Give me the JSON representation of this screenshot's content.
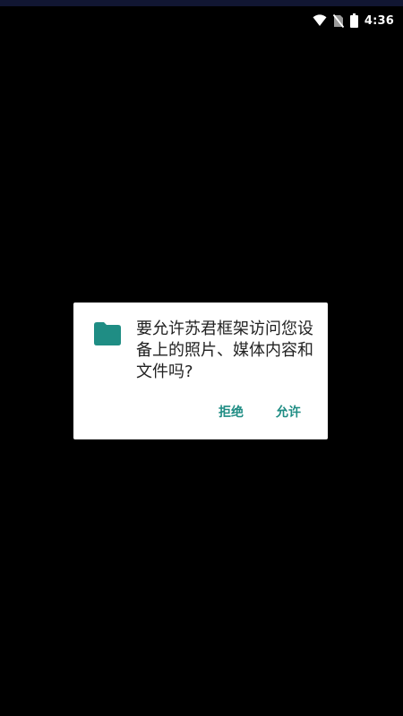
{
  "status_bar": {
    "time": "4:36",
    "icons": [
      "wifi-icon",
      "no-sim-icon",
      "battery-icon"
    ]
  },
  "dialog": {
    "icon": "folder-icon",
    "message": "要允许苏君框架访问您设备上的照片、媒体内容和文件吗?",
    "deny_label": "拒绝",
    "allow_label": "允许"
  },
  "colors": {
    "background": "#000000",
    "accent": "#1f8d84",
    "dialog_background": "#ffffff",
    "status_bar_top": "#111632"
  }
}
